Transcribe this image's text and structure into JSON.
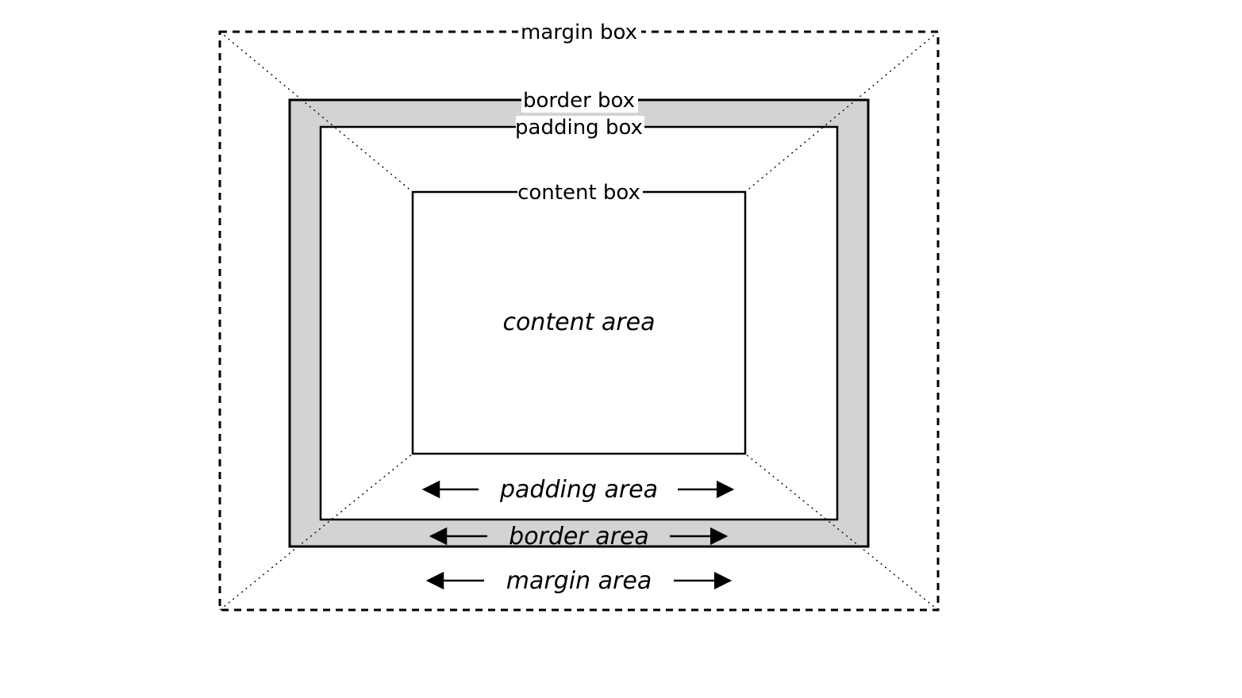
{
  "boxes": {
    "margin": {
      "label": "margin box"
    },
    "border": {
      "label": "border box"
    },
    "padding": {
      "label": "padding box"
    },
    "content": {
      "label": "content box"
    }
  },
  "areas": {
    "content": {
      "label": "content area"
    },
    "padding": {
      "label": "padding area"
    },
    "border": {
      "label": "border area"
    },
    "margin": {
      "label": "margin area"
    }
  },
  "geometry_note": "Concentric rectangles: dashed margin box (outer), solid border box with grey fill between its edges (border area), solid padding box, solid content box (inner). Dotted diagonal lines connect the four corners of the margin box to the four corners of the content box. Box-name labels sit on the top edges of their rectangles; area labels (italic) sit inside the corresponding region, the three outer ones flanked by horizontal double-headed arrows."
}
